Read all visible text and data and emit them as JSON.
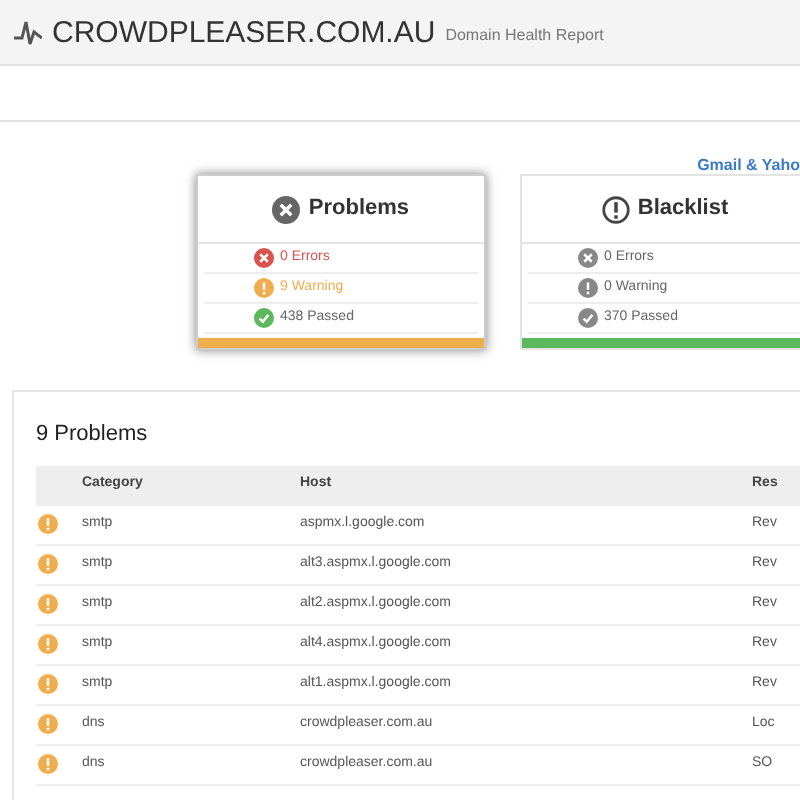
{
  "header": {
    "brand": "CROWDPLEASER.COM.AU",
    "subtitle": "Domain Health Report"
  },
  "link": "Gmail & Yaho",
  "cards": [
    {
      "title": "Problems",
      "kind": "error",
      "selected": true,
      "color": "#f0ad4e",
      "items": [
        {
          "kind": "error",
          "text": "0 Errors",
          "color": "#d9534f"
        },
        {
          "kind": "warning",
          "text": "9 Warning",
          "color": "#f0ad4e"
        },
        {
          "kind": "passed",
          "text": "438 Passed",
          "color": "#5cb85c"
        }
      ]
    },
    {
      "title": "Blacklist",
      "kind": "warning",
      "selected": false,
      "color": "#5cb85c",
      "items": [
        {
          "kind": "error",
          "text": "0 Errors",
          "color": "#888888"
        },
        {
          "kind": "warning",
          "text": "0 Warning",
          "color": "#888888"
        },
        {
          "kind": "passed",
          "text": "370 Passed",
          "color": "#888888"
        }
      ]
    }
  ],
  "table": {
    "title": "9 Problems",
    "columns": [
      "Category",
      "Host",
      "Res"
    ],
    "rows": [
      {
        "category": "smtp",
        "host": "aspmx.l.google.com",
        "result": "Rev"
      },
      {
        "category": "smtp",
        "host": "alt3.aspmx.l.google.com",
        "result": "Rev"
      },
      {
        "category": "smtp",
        "host": "alt2.aspmx.l.google.com",
        "result": "Rev"
      },
      {
        "category": "smtp",
        "host": "alt4.aspmx.l.google.com",
        "result": "Rev"
      },
      {
        "category": "smtp",
        "host": "alt1.aspmx.l.google.com",
        "result": "Rev"
      },
      {
        "category": "dns",
        "host": "crowdpleaser.com.au",
        "result": "Loc"
      },
      {
        "category": "dns",
        "host": "crowdpleaser.com.au",
        "result": "SO"
      }
    ]
  }
}
